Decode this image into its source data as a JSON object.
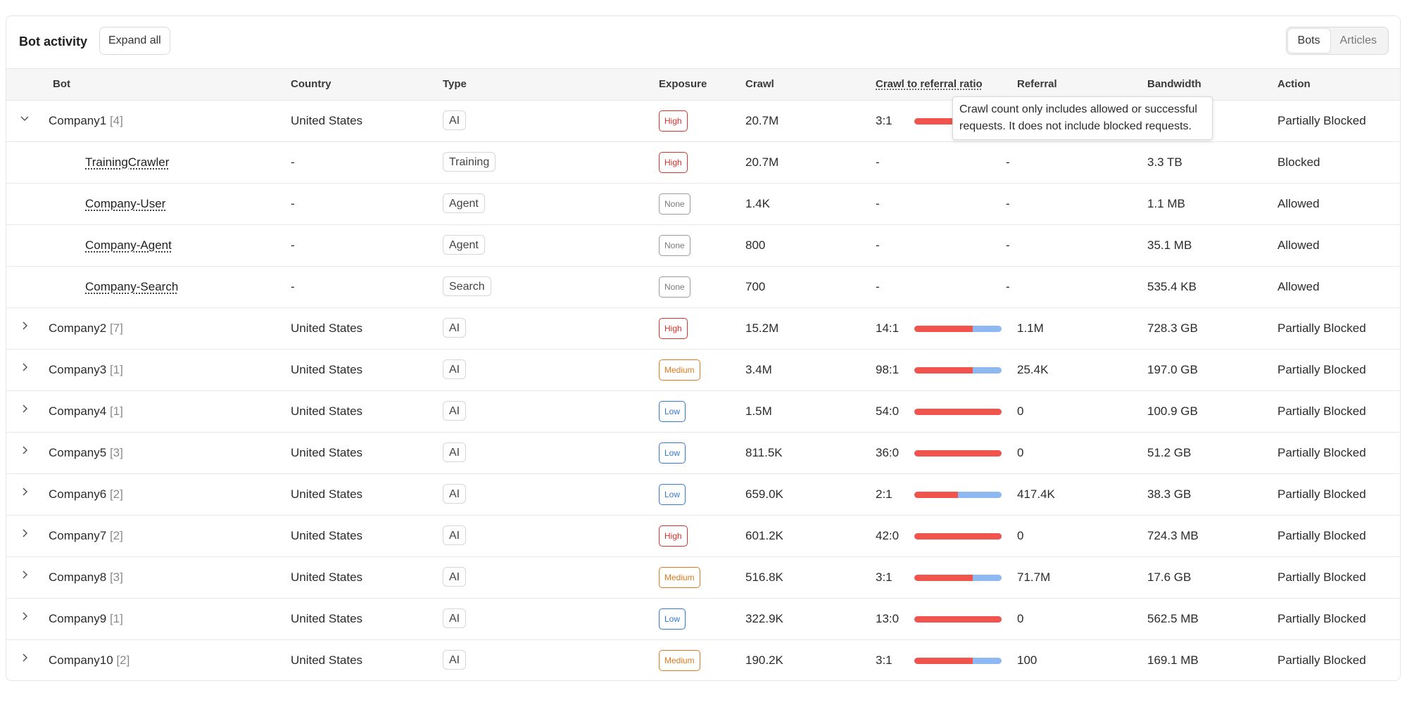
{
  "header": {
    "title": "Bot activity",
    "expand_label": "Expand all"
  },
  "view_toggle": {
    "bots": "Bots",
    "articles": "Articles",
    "selected": "Bots"
  },
  "columns": {
    "bot": "Bot",
    "country": "Country",
    "type": "Type",
    "exposure": "Exposure",
    "crawl": "Crawl",
    "ratio": "Crawl to referral ratio",
    "referral": "Referral",
    "bandwidth": "Bandwidth",
    "action": "Action"
  },
  "tooltip": "Crawl count only includes allowed or successful requests. It does not include blocked requests.",
  "rows": [
    {
      "kind": "parent",
      "expanded": true,
      "name": "Company1",
      "count": "[4]",
      "country": "United States",
      "type": "AI",
      "exposure": "High",
      "crawl": "20.7M",
      "ratio": "3:1",
      "ratio_fraction": 0.75,
      "referral": "",
      "bandwidth": "",
      "action": "Partially Blocked"
    },
    {
      "kind": "child",
      "name": "TrainingCrawler",
      "country": "-",
      "type": "Training",
      "exposure": "High",
      "crawl": "20.7M",
      "ratio": "-",
      "referral": "-",
      "bandwidth": "3.3 TB",
      "action": "Blocked"
    },
    {
      "kind": "child",
      "name": "Company-User",
      "country": "-",
      "type": "Agent",
      "exposure": "None",
      "crawl": "1.4K",
      "ratio": "-",
      "referral": "-",
      "bandwidth": "1.1 MB",
      "action": "Allowed"
    },
    {
      "kind": "child",
      "name": "Company-Agent",
      "country": "-",
      "type": "Agent",
      "exposure": "None",
      "crawl": "800",
      "ratio": "-",
      "referral": "-",
      "bandwidth": "35.1 MB",
      "action": "Allowed"
    },
    {
      "kind": "child",
      "name": "Company-Search",
      "country": "-",
      "type": "Search",
      "exposure": "None",
      "crawl": "700",
      "ratio": "-",
      "referral": "-",
      "bandwidth": "535.4 KB",
      "action": "Allowed"
    },
    {
      "kind": "parent",
      "expanded": false,
      "name": "Company2",
      "count": "[7]",
      "country": "United States",
      "type": "AI",
      "exposure": "High",
      "crawl": "15.2M",
      "ratio": "14:1",
      "ratio_fraction": 0.67,
      "referral": "1.1M",
      "bandwidth": "728.3 GB",
      "action": "Partially Blocked"
    },
    {
      "kind": "parent",
      "expanded": false,
      "name": "Company3",
      "count": "[1]",
      "country": "United States",
      "type": "AI",
      "exposure": "Medium",
      "crawl": "3.4M",
      "ratio": "98:1",
      "ratio_fraction": 0.67,
      "referral": "25.4K",
      "bandwidth": "197.0 GB",
      "action": "Partially Blocked"
    },
    {
      "kind": "parent",
      "expanded": false,
      "name": "Company4",
      "count": "[1]",
      "country": "United States",
      "type": "AI",
      "exposure": "Low",
      "crawl": "1.5M",
      "ratio": "54:0",
      "ratio_fraction": 1.0,
      "referral": "0",
      "bandwidth": "100.9 GB",
      "action": "Partially Blocked"
    },
    {
      "kind": "parent",
      "expanded": false,
      "name": "Company5",
      "count": "[3]",
      "country": "United States",
      "type": "AI",
      "exposure": "Low",
      "crawl": "811.5K",
      "ratio": "36:0",
      "ratio_fraction": 1.0,
      "referral": "0",
      "bandwidth": "51.2 GB",
      "action": "Partially Blocked"
    },
    {
      "kind": "parent",
      "expanded": false,
      "name": "Company6",
      "count": "[2]",
      "country": "United States",
      "type": "AI",
      "exposure": "Low",
      "crawl": "659.0K",
      "ratio": "2:1",
      "ratio_fraction": 0.5,
      "referral": "417.4K",
      "bandwidth": "38.3 GB",
      "action": "Partially Blocked"
    },
    {
      "kind": "parent",
      "expanded": false,
      "name": "Company7",
      "count": "[2]",
      "country": "United States",
      "type": "AI",
      "exposure": "High",
      "crawl": "601.2K",
      "ratio": "42:0",
      "ratio_fraction": 1.0,
      "referral": "0",
      "bandwidth": "724.3 MB",
      "action": "Partially Blocked"
    },
    {
      "kind": "parent",
      "expanded": false,
      "name": "Company8",
      "count": "[3]",
      "country": "United States",
      "type": "AI",
      "exposure": "Medium",
      "crawl": "516.8K",
      "ratio": "3:1",
      "ratio_fraction": 0.67,
      "referral": "71.7M",
      "bandwidth": "17.6 GB",
      "action": "Partially Blocked"
    },
    {
      "kind": "parent",
      "expanded": false,
      "name": "Company9",
      "count": "[1]",
      "country": "United States",
      "type": "AI",
      "exposure": "Low",
      "crawl": "322.9K",
      "ratio": "13:0",
      "ratio_fraction": 1.0,
      "referral": "0",
      "bandwidth": "562.5 MB",
      "action": "Partially Blocked"
    },
    {
      "kind": "parent",
      "expanded": false,
      "name": "Company10",
      "count": "[2]",
      "country": "United States",
      "type": "AI",
      "exposure": "Medium",
      "crawl": "190.2K",
      "ratio": "3:1",
      "ratio_fraction": 0.67,
      "referral": "100",
      "bandwidth": "169.1 MB",
      "action": "Partially Blocked"
    }
  ],
  "colors": {
    "bar_crawl": "#f0544c",
    "bar_referral": "#8db8f2",
    "high": "#d8332a",
    "medium": "#df7a1c",
    "low": "#3478d6",
    "none": "#7a7a7a"
  },
  "icons": {
    "expanded": "chevron-down-icon",
    "collapsed": "chevron-right-icon"
  }
}
